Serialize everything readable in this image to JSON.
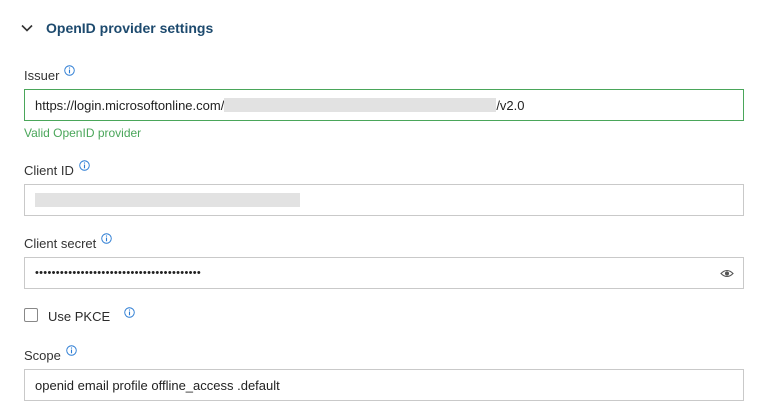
{
  "section": {
    "title": "OpenID provider settings"
  },
  "issuer": {
    "label": "Issuer",
    "value_prefix": "https://login.microsoftonline.com/",
    "value_suffix": "/v2.0",
    "validation": "Valid OpenID provider"
  },
  "client_id": {
    "label": "Client ID"
  },
  "client_secret": {
    "label": "Client secret",
    "value": "••••••••••••••••••••••••••••••••••••••••"
  },
  "pkce": {
    "label": "Use PKCE",
    "checked": false
  },
  "scope": {
    "label": "Scope",
    "value": "openid email profile offline_access .default"
  },
  "colors": {
    "accent": "#1d4a6e",
    "valid": "#4aa65a",
    "info": "#2a7bd3"
  },
  "icons": [
    "chevron-down-icon",
    "info-icon",
    "eye-icon"
  ]
}
